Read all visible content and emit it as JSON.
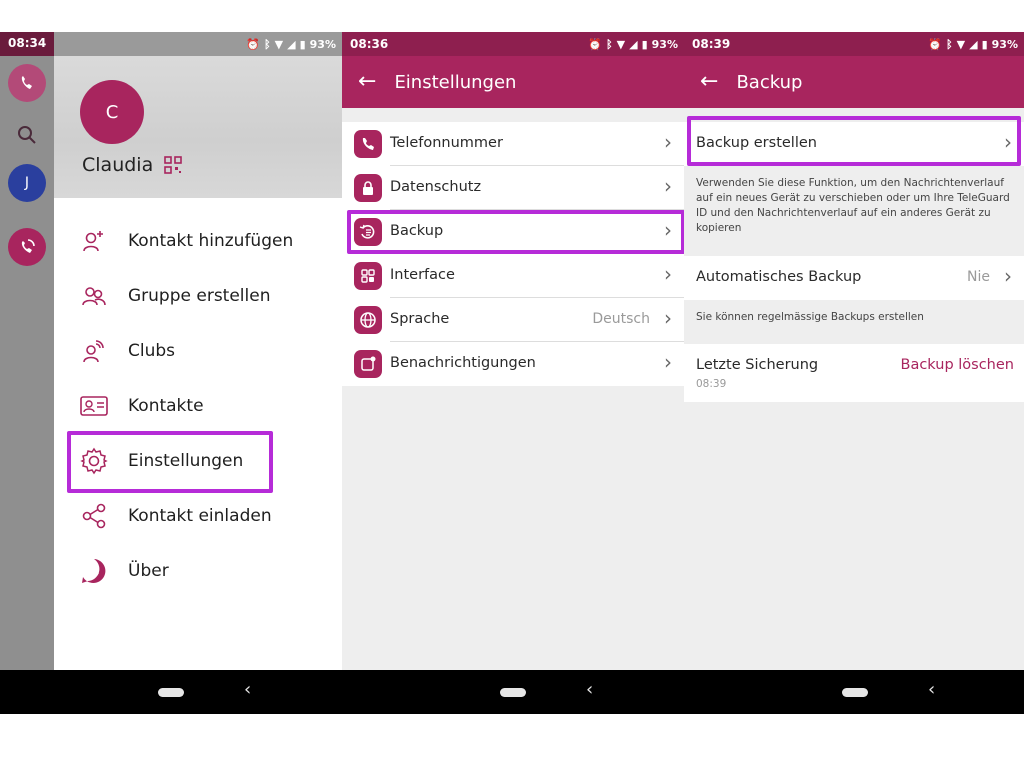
{
  "colors": {
    "accent": "#a8255e",
    "highlight": "#b62bd8"
  },
  "status_icons": [
    "alarm-icon",
    "nfc-icon",
    "bluetooth-icon",
    "mute-icon",
    "wifi-icon",
    "signal-icon",
    "battery-icon"
  ],
  "panel1": {
    "time": "08:34",
    "battery": "93%",
    "rail_avatar": "J",
    "profile_initial": "C",
    "profile_name": "Claudia",
    "menu": [
      {
        "label": "Kontakt hinzufügen",
        "icon": "add-contact-icon"
      },
      {
        "label": "Gruppe erstellen",
        "icon": "group-icon"
      },
      {
        "label": "Clubs",
        "icon": "clubs-icon"
      },
      {
        "label": "Kontakte",
        "icon": "contacts-card-icon"
      },
      {
        "label": "Einstellungen",
        "icon": "gear-icon"
      },
      {
        "label": "Kontakt einladen",
        "icon": "share-icon"
      },
      {
        "label": "Über",
        "icon": "app-logo-icon"
      }
    ]
  },
  "panel2": {
    "time": "08:36",
    "battery": "93%",
    "title": "Einstellungen",
    "items": [
      {
        "label": "Telefonnummer",
        "value": "",
        "icon": "phone-icon"
      },
      {
        "label": "Datenschutz",
        "value": "",
        "icon": "lock-icon"
      },
      {
        "label": "Backup",
        "value": "",
        "icon": "backup-icon"
      },
      {
        "label": "Interface",
        "value": "",
        "icon": "grid-icon"
      },
      {
        "label": "Sprache",
        "value": "Deutsch",
        "icon": "globe-icon"
      },
      {
        "label": "Benachrichtigungen",
        "value": "",
        "icon": "notification-icon"
      }
    ]
  },
  "panel3": {
    "time": "08:39",
    "battery": "93%",
    "title": "Backup",
    "create_label": "Backup erstellen",
    "create_desc": "Verwenden Sie diese Funktion, um den Nachrichtenverlauf auf ein neues Gerät zu verschieben oder um Ihre TeleGuard ID und den Nachrichtenverlauf auf ein anderes Gerät zu kopieren",
    "auto_label": "Automatisches Backup",
    "auto_value": "Nie",
    "auto_desc": "Sie können regelmässige Backups erstellen",
    "last_label": "Letzte Sicherung",
    "last_time": "08:39",
    "delete_label": "Backup löschen"
  }
}
